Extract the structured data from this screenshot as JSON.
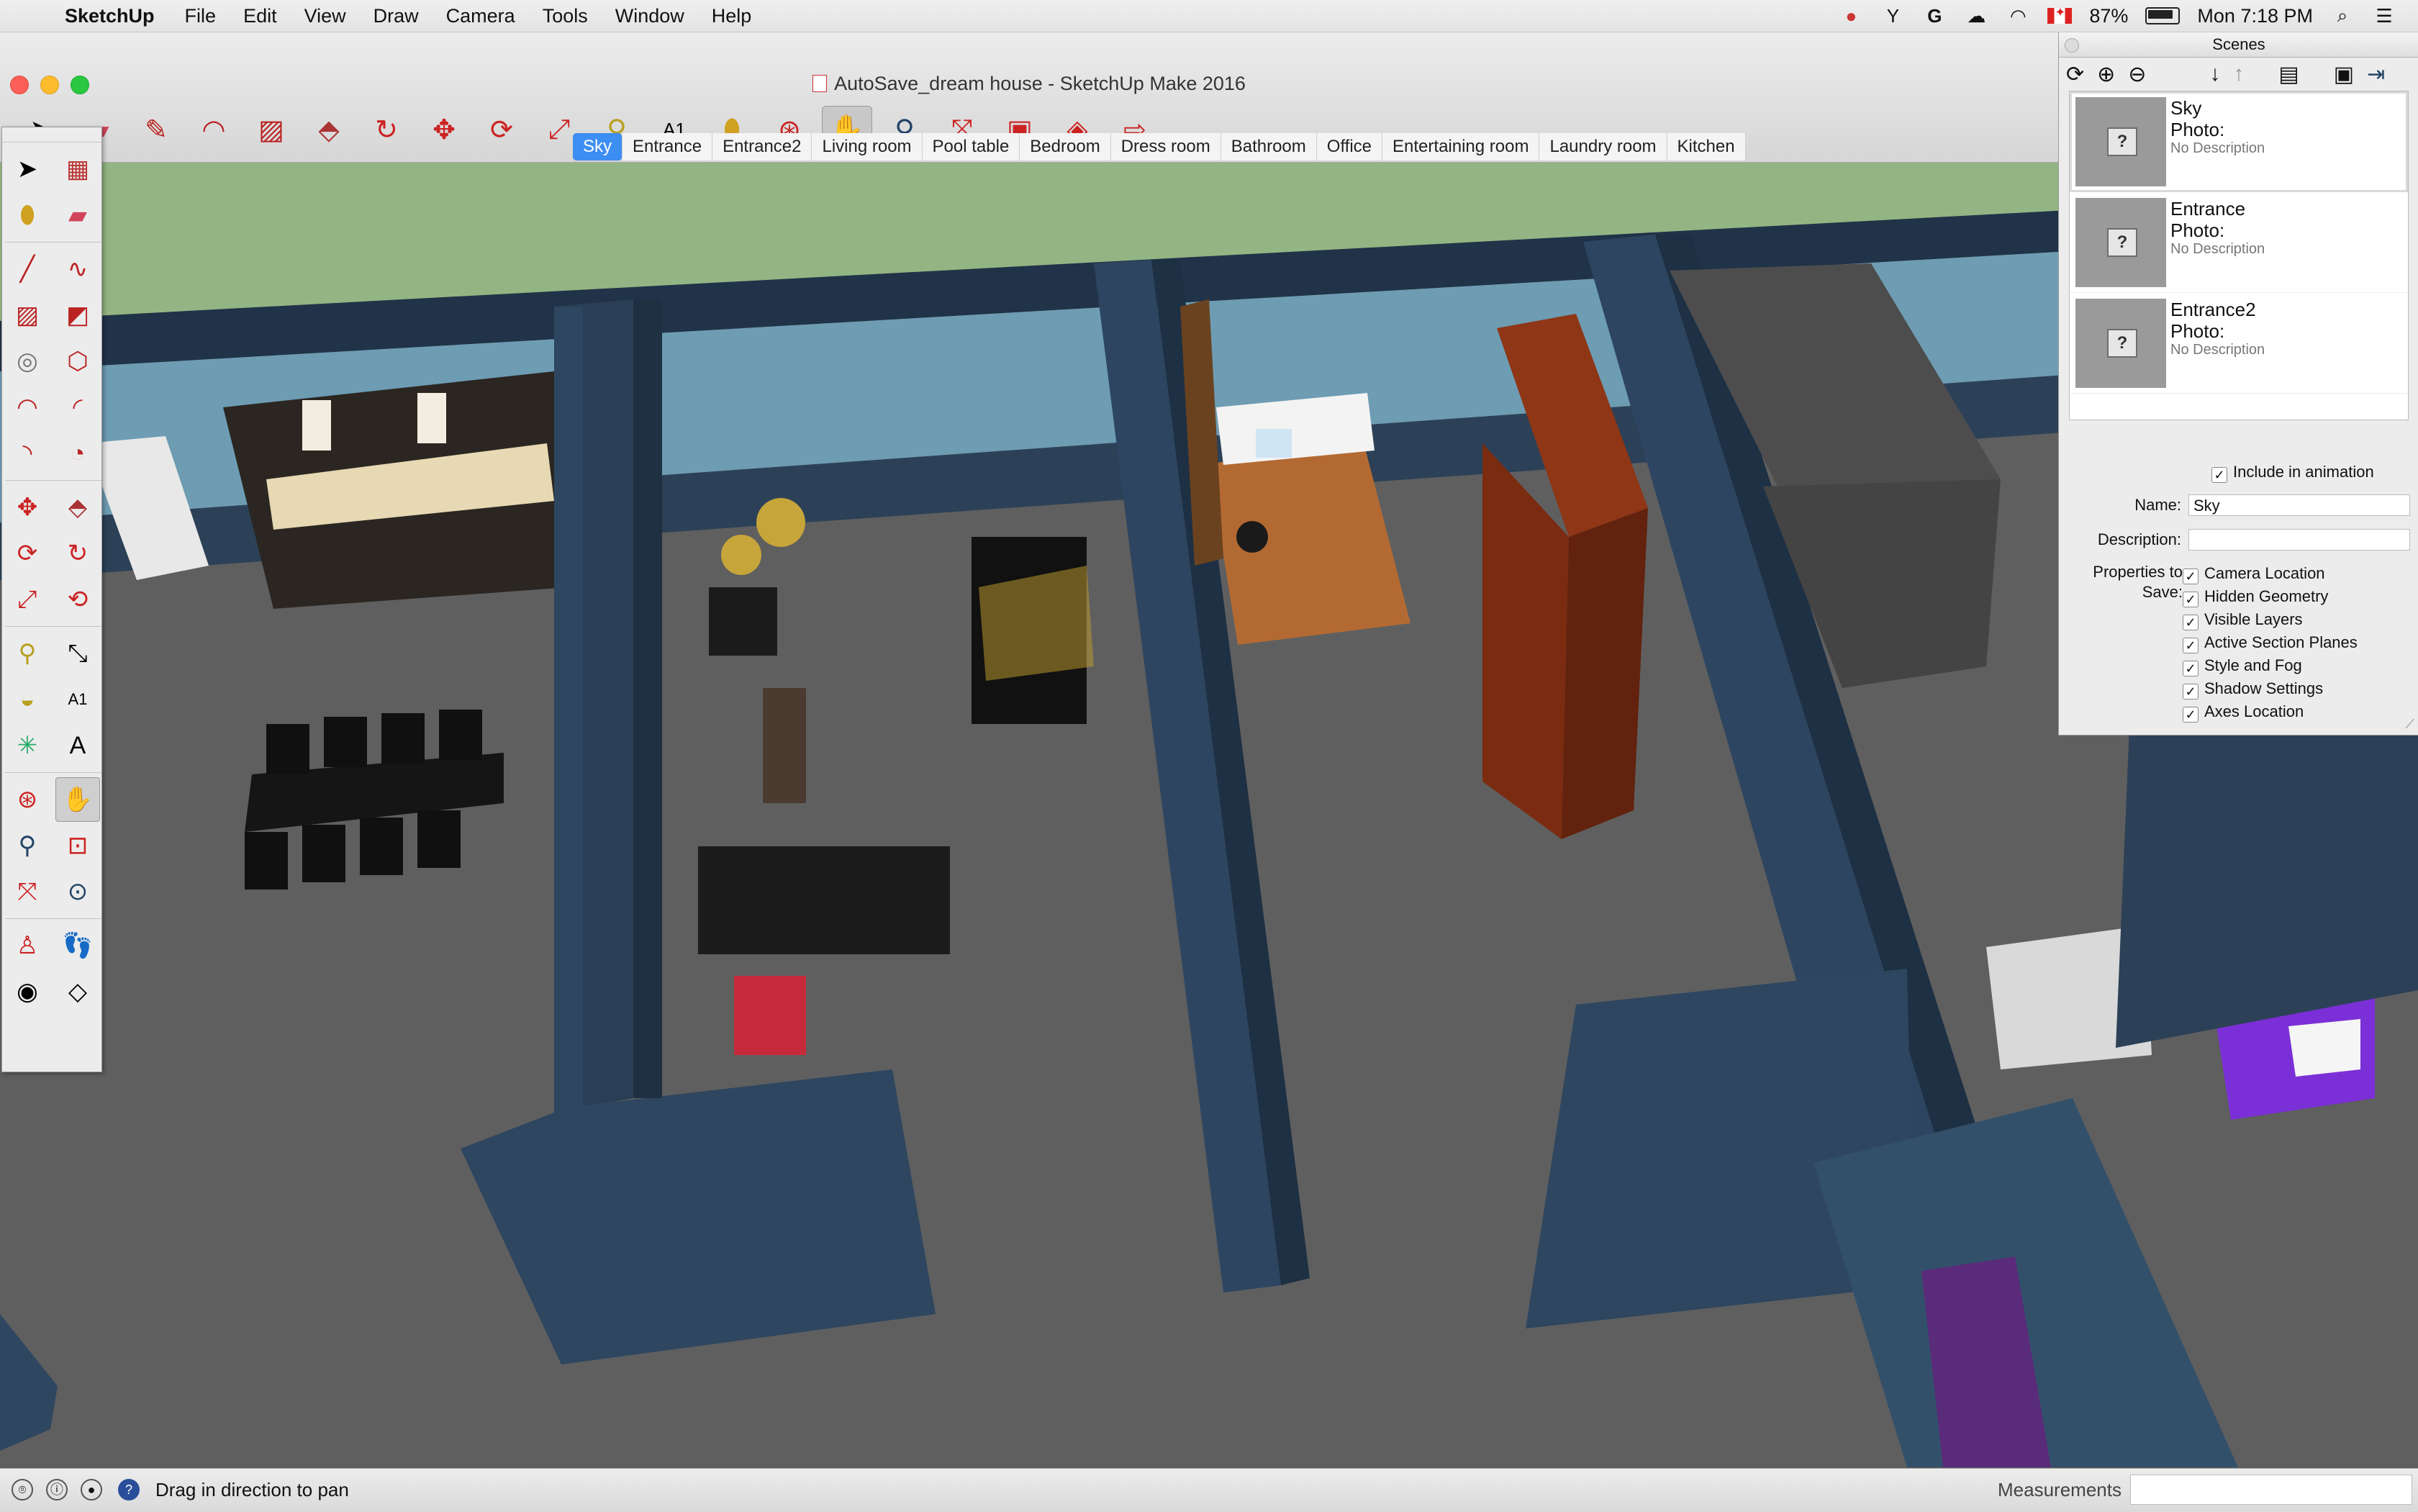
{
  "menubar": {
    "app": "SketchUp",
    "menus": [
      "File",
      "Edit",
      "View",
      "Draw",
      "Camera",
      "Tools",
      "Window",
      "Help"
    ],
    "status": {
      "battery": "87%",
      "clock": "Mon 7:18 PM"
    }
  },
  "window": {
    "title": "AutoSave_dream house - SketchUp Make 2016"
  },
  "toolbar": {
    "tools": [
      "select",
      "eraser",
      "pencil",
      "arc",
      "rectangle",
      "push-pull",
      "follow-me",
      "move",
      "rotate",
      "scale",
      "tape-measure",
      "text",
      "paint-bucket",
      "orbit",
      "pan",
      "zoom",
      "zoom-extents",
      "3d-warehouse",
      "extension-warehouse",
      "send-to-layout"
    ],
    "active": "pan"
  },
  "scene_tabs": {
    "tabs": [
      "Sky",
      "Entrance",
      "Entrance2",
      "Living room",
      "Pool table",
      "Bedroom",
      "Dress room",
      "Bathroom",
      "Office",
      "Entertaining room",
      "Laundry room",
      "Kitchen"
    ],
    "active": "Sky"
  },
  "scenes_panel": {
    "title": "Scenes",
    "scenes": [
      {
        "name": "Sky",
        "photo": "Photo:",
        "description": "No Description"
      },
      {
        "name": "Entrance",
        "photo": "Photo:",
        "description": "No Description"
      },
      {
        "name": "Entrance2",
        "photo": "Photo:",
        "description": "No Description"
      }
    ],
    "include_in_animation": "Include in animation",
    "name_label": "Name:",
    "name_value": "Sky",
    "description_label": "Description:",
    "description_value": "",
    "properties_label_1": "Properties to",
    "properties_label_2": "Save:",
    "properties": [
      "Camera Location",
      "Hidden Geometry",
      "Visible Layers",
      "Active Section Planes",
      "Style and Fog",
      "Shadow Settings",
      "Axes Location"
    ]
  },
  "statusbar": {
    "hint": "Drag in direction to pan",
    "measurements_label": "Measurements",
    "measurements_value": ""
  },
  "colors": {
    "sky": "#93b583",
    "wall_top": "#223449",
    "wall_side": "#33506a",
    "floor": "#5e5e5e",
    "accent": "#3d8ef2"
  }
}
